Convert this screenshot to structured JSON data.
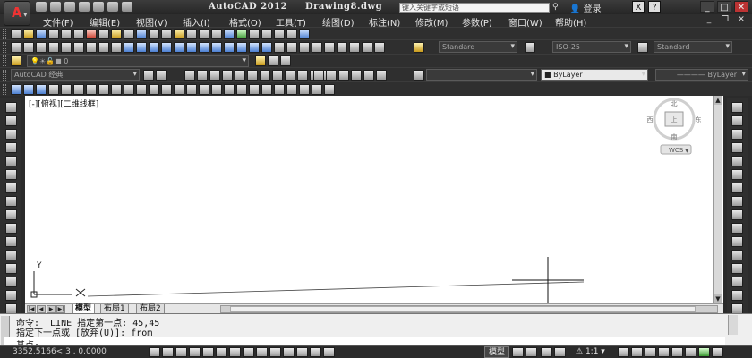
{
  "titlebar": {
    "app_title": "AutoCAD 2012",
    "document": "Drawing8.dwg",
    "search_placeholder": "键入关键字或短语",
    "login": "登录"
  },
  "menu": [
    "文件(F)",
    "编辑(E)",
    "视图(V)",
    "插入(I)",
    "格式(O)",
    "工具(T)",
    "绘图(D)",
    "标注(N)",
    "修改(M)",
    "参数(P)",
    "窗口(W)",
    "帮助(H)"
  ],
  "toolbars": {
    "text_style": "Standard",
    "dim_style": "ISO-25",
    "table_style": "Standard",
    "layer_value": "0",
    "workspace": "AutoCAD 经典",
    "color": "ByLayer",
    "linetype": "ByLayer"
  },
  "viewport": {
    "label": "[-][俯视][二维线框]",
    "viewcube": {
      "north": "北",
      "south": "南",
      "east": "东",
      "west": "西",
      "top": "上",
      "wcs": "WCS"
    },
    "ucs_y": "Y",
    "ucs_x": "X"
  },
  "tabs": [
    "模型",
    "布局1",
    "布局2"
  ],
  "command": {
    "line1": "命令: _LINE 指定第一点: 45,45",
    "line2": "指定下一点或 [放弃(U)]: from",
    "prompt": "基点:"
  },
  "status": {
    "coordinates": "3352.5166< 3     , 0.0000",
    "model_label": "模型",
    "annotation_scale": "1:1"
  },
  "colors": {
    "app_bg": "#2b2b2b",
    "canvas": "#ffffff",
    "close_button": "#bb3333",
    "logo_red": "#ee3333"
  }
}
